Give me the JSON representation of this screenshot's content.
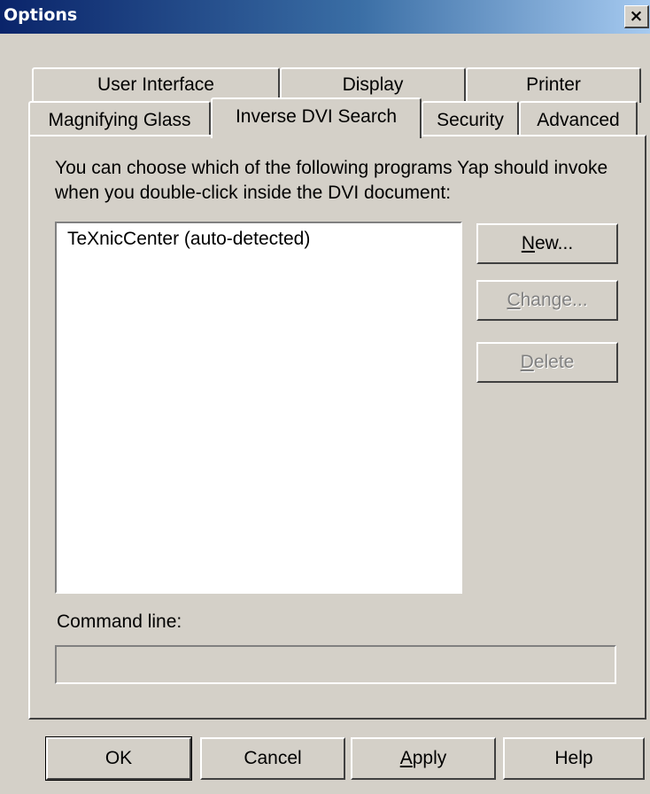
{
  "window": {
    "title": "Options",
    "close_glyph": "×"
  },
  "tabs": {
    "row1": [
      "User Interface",
      "Display",
      "Printer"
    ],
    "row2": [
      "Magnifying Glass",
      "Inverse DVI Search",
      "Security",
      "Advanced"
    ],
    "active": "Inverse DVI Search"
  },
  "panel": {
    "description": "You can choose which of the following programs Yap should invoke when you double-click inside the DVI document:",
    "programs": [
      "TeXnicCenter (auto-detected)"
    ],
    "buttons": {
      "new": {
        "mnemonic": "N",
        "rest": "ew...",
        "enabled": true
      },
      "change": {
        "mnemonic": "C",
        "rest": "hange...",
        "enabled": false
      },
      "delete": {
        "mnemonic": "D",
        "rest": "elete",
        "enabled": false
      }
    },
    "command_line_label": "Command line:",
    "command_line_value": ""
  },
  "footer": {
    "ok": "OK",
    "cancel": "Cancel",
    "apply_mnemonic": "A",
    "apply_rest": "pply",
    "help": "Help"
  }
}
